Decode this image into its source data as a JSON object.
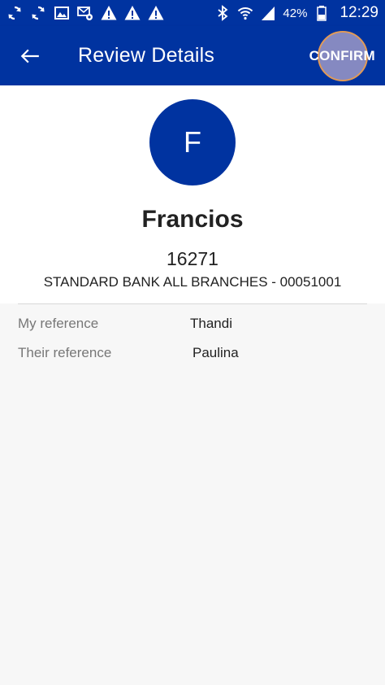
{
  "status_bar": {
    "icons_left": [
      "sync-icon",
      "sync-icon",
      "image-icon",
      "message-settings-icon",
      "warning-icon",
      "warning-icon",
      "warning-icon"
    ],
    "icons_right": [
      "bluetooth-icon",
      "wifi-icon",
      "signal-icon"
    ],
    "battery": "42%",
    "time": "12:29"
  },
  "app_bar": {
    "title": "Review Details",
    "confirm_label": "CONFIRM",
    "back_icon": "back-arrow-icon"
  },
  "recipient": {
    "initial": "F",
    "name": "Francios",
    "account_number": "16271",
    "bank": "STANDARD BANK ALL BRANCHES - 00051001"
  },
  "details": {
    "my_reference": {
      "label": "My reference",
      "value": "Thandi"
    },
    "their_reference": {
      "label": "Their reference",
      "value": "Paulina"
    }
  },
  "colors": {
    "primary": "#0033a0",
    "ripple": "#b9aacd",
    "ripple_border": "#e19a57"
  }
}
